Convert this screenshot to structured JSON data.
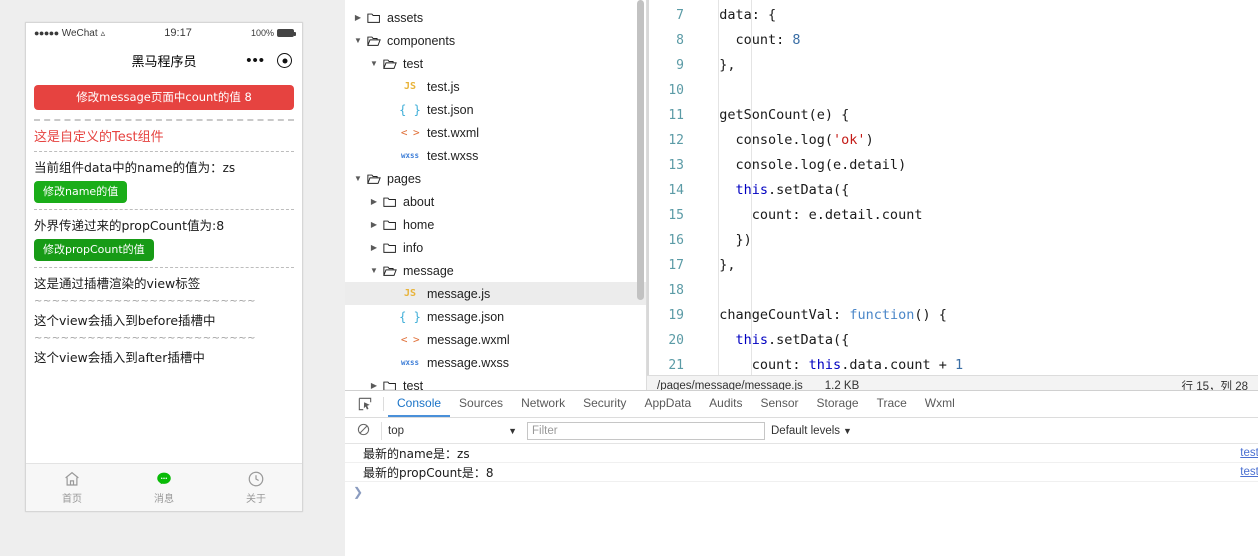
{
  "simulator": {
    "status_bar": {
      "signal_dots": "●●●●●",
      "carrier": "WeChat",
      "wifi_icon": "wifi-icon",
      "time": "19:17",
      "battery_percent": "100%"
    },
    "nav": {
      "title": "黑马程序员",
      "more_icon": "more-dots-icon",
      "target_icon": "target-circle-icon"
    },
    "page": {
      "warn_button": "修改message页面中count的值 8",
      "component_title": "这是自定义的Test组件",
      "name_line": "当前组件data中的name的值为：",
      "name_value": "zs",
      "name_button": "修改name的值",
      "prop_line": "外界传递过来的propCount值为:8",
      "prop_button": "修改propCount的值",
      "slot_default": "这是通过插槽渲染的view标签",
      "slot_before": "这个view会插入到before插槽中",
      "slot_after": "这个view会插入到after插槽中",
      "wave_sep": "~~~~~~~~~~~~~~~~~~~~~~~~~"
    },
    "tabbar": [
      {
        "label": "首页",
        "icon": "home-icon",
        "active": false
      },
      {
        "label": "消息",
        "icon": "message-bubble-icon",
        "active": true
      },
      {
        "label": "关于",
        "icon": "clock-about-icon",
        "active": false
      }
    ],
    "colors": {
      "warn": "#e64340",
      "primary": "#1aad19",
      "primary_pressed": "#179b16",
      "tab_active": "#09bb07"
    }
  },
  "explorer": {
    "tree": [
      {
        "depth": 0,
        "label": "assets",
        "type": "folder",
        "expanded": false,
        "selected": false
      },
      {
        "depth": 0,
        "label": "components",
        "type": "folder",
        "expanded": true,
        "selected": false
      },
      {
        "depth": 1,
        "label": "test",
        "type": "folder",
        "expanded": true,
        "selected": false
      },
      {
        "depth": 2,
        "label": "test.js",
        "type": "js",
        "expanded": null,
        "selected": false
      },
      {
        "depth": 2,
        "label": "test.json",
        "type": "json",
        "expanded": null,
        "selected": false
      },
      {
        "depth": 2,
        "label": "test.wxml",
        "type": "wxml",
        "expanded": null,
        "selected": false
      },
      {
        "depth": 2,
        "label": "test.wxss",
        "type": "wxss",
        "expanded": null,
        "selected": false
      },
      {
        "depth": 0,
        "label": "pages",
        "type": "folder",
        "expanded": true,
        "selected": false
      },
      {
        "depth": 1,
        "label": "about",
        "type": "folder",
        "expanded": false,
        "selected": false
      },
      {
        "depth": 1,
        "label": "home",
        "type": "folder",
        "expanded": false,
        "selected": false
      },
      {
        "depth": 1,
        "label": "info",
        "type": "folder",
        "expanded": false,
        "selected": false
      },
      {
        "depth": 1,
        "label": "message",
        "type": "folder",
        "expanded": true,
        "selected": false
      },
      {
        "depth": 2,
        "label": "message.js",
        "type": "js",
        "expanded": null,
        "selected": true
      },
      {
        "depth": 2,
        "label": "message.json",
        "type": "json",
        "expanded": null,
        "selected": false
      },
      {
        "depth": 2,
        "label": "message.wxml",
        "type": "wxml",
        "expanded": null,
        "selected": false
      },
      {
        "depth": 2,
        "label": "message.wxss",
        "type": "wxss",
        "expanded": null,
        "selected": false
      },
      {
        "depth": 1,
        "label": "test",
        "type": "folder",
        "expanded": false,
        "selected": false
      }
    ],
    "tags": {
      "js": "JS",
      "json": "{ }",
      "wxml": "< >",
      "wxss": "wxss"
    }
  },
  "editor": {
    "lines": [
      {
        "num": "7",
        "tokens": [
          {
            "t": "  data: {",
            "c": "plain"
          }
        ]
      },
      {
        "num": "8",
        "tokens": [
          {
            "t": "    count: ",
            "c": "plain"
          },
          {
            "t": "8",
            "c": "num"
          }
        ]
      },
      {
        "num": "9",
        "tokens": [
          {
            "t": "  },",
            "c": "plain"
          }
        ]
      },
      {
        "num": "10",
        "tokens": [
          {
            "t": "",
            "c": "plain"
          }
        ]
      },
      {
        "num": "11",
        "tokens": [
          {
            "t": "  getSonCount(e) {",
            "c": "plain"
          }
        ]
      },
      {
        "num": "12",
        "tokens": [
          {
            "t": "    console.log(",
            "c": "plain"
          },
          {
            "t": "'ok'",
            "c": "str"
          },
          {
            "t": ")",
            "c": "plain"
          }
        ]
      },
      {
        "num": "13",
        "tokens": [
          {
            "t": "    console.log(e.detail)",
            "c": "plain"
          }
        ]
      },
      {
        "num": "14",
        "tokens": [
          {
            "t": "    ",
            "c": "plain"
          },
          {
            "t": "this",
            "c": "key"
          },
          {
            "t": ".setData({",
            "c": "plain"
          }
        ]
      },
      {
        "num": "15",
        "tokens": [
          {
            "t": "      count: e.detail.count",
            "c": "plain"
          }
        ]
      },
      {
        "num": "16",
        "tokens": [
          {
            "t": "    })",
            "c": "plain"
          }
        ]
      },
      {
        "num": "17",
        "tokens": [
          {
            "t": "  },",
            "c": "plain"
          }
        ]
      },
      {
        "num": "18",
        "tokens": [
          {
            "t": "",
            "c": "plain"
          }
        ]
      },
      {
        "num": "19",
        "tokens": [
          {
            "t": "  changeCountVal: ",
            "c": "plain"
          },
          {
            "t": "function",
            "c": "fn"
          },
          {
            "t": "() {",
            "c": "plain"
          }
        ]
      },
      {
        "num": "20",
        "tokens": [
          {
            "t": "    ",
            "c": "plain"
          },
          {
            "t": "this",
            "c": "key"
          },
          {
            "t": ".setData({",
            "c": "plain"
          }
        ]
      },
      {
        "num": "21",
        "tokens": [
          {
            "t": "      count: ",
            "c": "plain"
          },
          {
            "t": "this",
            "c": "key"
          },
          {
            "t": ".data.count + ",
            "c": "plain"
          },
          {
            "t": "1",
            "c": "num"
          }
        ]
      }
    ]
  },
  "statusbar": {
    "path": "/pages/message/message.js",
    "size": "1.2 KB",
    "position": "行 15，列 28"
  },
  "devtools": {
    "inspect_icon": "inspect-element-icon",
    "tabs": [
      {
        "label": "Console",
        "active": true
      },
      {
        "label": "Sources",
        "active": false
      },
      {
        "label": "Network",
        "active": false
      },
      {
        "label": "Security",
        "active": false
      },
      {
        "label": "AppData",
        "active": false
      },
      {
        "label": "Audits",
        "active": false
      },
      {
        "label": "Sensor",
        "active": false
      },
      {
        "label": "Storage",
        "active": false
      },
      {
        "label": "Trace",
        "active": false
      },
      {
        "label": "Wxml",
        "active": false
      }
    ],
    "toolbar": {
      "clear_icon": "clear-console-icon",
      "context": "top",
      "context_caret": "▼",
      "filter_placeholder": "Filter",
      "levels": "Default levels",
      "levels_caret": "▼"
    },
    "messages": [
      {
        "text": "最新的name是：zs",
        "source": "test."
      },
      {
        "text": "最新的propCount是：8",
        "source": "test."
      }
    ],
    "prompt": "❯"
  }
}
